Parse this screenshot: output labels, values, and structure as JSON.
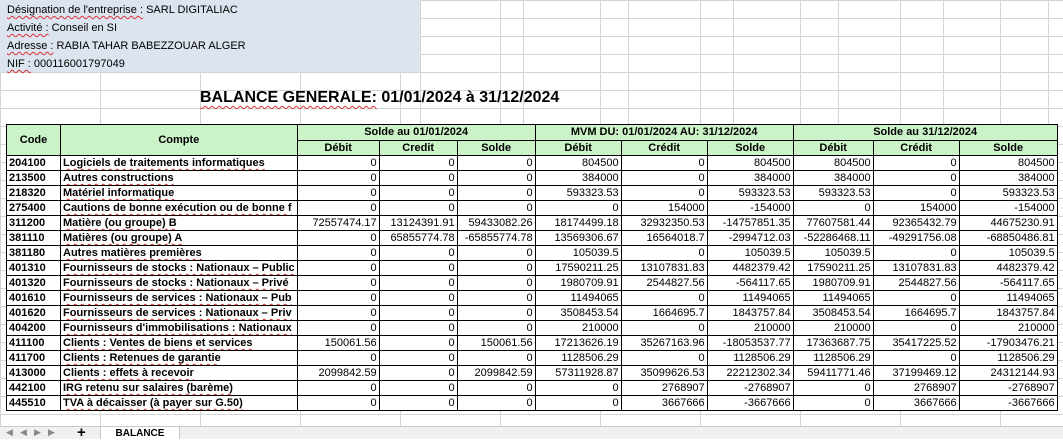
{
  "company": {
    "designation_label": "Désignation de l'entreprise :",
    "designation_value": "SARL DIGITALIAC",
    "activity_label": "Activité :",
    "activity_value": "Conseil en SI",
    "address_label": "Adresse :",
    "address_value": "RABIA TAHAR BABEZZOUAR ALGER",
    "nif_label": "NIF :",
    "nif_value": "000116001797049"
  },
  "title": {
    "main": "BALANCE GENERALE:",
    "period": "01/01/2024 à 31/12/2024"
  },
  "table": {
    "col_code": "Code",
    "col_compte": "Compte",
    "group1": "Solde au 01/01/2024",
    "group2": "MVM DU: 01/01/2024 AU: 31/12/2024",
    "group3": "Solde au 31/12/2024",
    "sub": {
      "debit": "Débit",
      "credit1": "Credit",
      "credit2": "Crédit",
      "solde": "Solde"
    },
    "rows": [
      {
        "code": "204100",
        "compte": "Logiciels de traitements informatiques",
        "v": [
          "0",
          "0",
          "0",
          "804500",
          "0",
          "804500",
          "804500",
          "0",
          "804500"
        ]
      },
      {
        "code": "213500",
        "compte": "Autres constructions",
        "v": [
          "0",
          "0",
          "0",
          "384000",
          "0",
          "384000",
          "384000",
          "0",
          "384000"
        ]
      },
      {
        "code": "218320",
        "compte": "Matériel informatique",
        "v": [
          "0",
          "0",
          "0",
          "593323.53",
          "0",
          "593323.53",
          "593323.53",
          "0",
          "593323.53"
        ]
      },
      {
        "code": "275400",
        "compte": "Cautions de bonne exécution ou de bonne f",
        "v": [
          "0",
          "0",
          "0",
          "0",
          "154000",
          "-154000",
          "0",
          "154000",
          "-154000"
        ]
      },
      {
        "code": "311200",
        "compte": "Matière (ou groupe) B",
        "v": [
          "72557474.17",
          "13124391.91",
          "59433082.26",
          "18174499.18",
          "32932350.53",
          "-14757851.35",
          "77607581.44",
          "92365432.79",
          "44675230.91"
        ]
      },
      {
        "code": "381110",
        "compte": "Matières (ou groupe) A",
        "v": [
          "0",
          "65855774.78",
          "-65855774.78",
          "13569306.67",
          "16564018.7",
          "-2994712.03",
          "-52286468.11",
          "-49291756.08",
          "-68850486.81"
        ]
      },
      {
        "code": "381180",
        "compte": "Autres matières premières",
        "v": [
          "0",
          "0",
          "0",
          "105039.5",
          "0",
          "105039.5",
          "105039.5",
          "0",
          "105039.5"
        ]
      },
      {
        "code": "401310",
        "compte": "Fournisseurs de stocks : Nationaux – Public",
        "v": [
          "0",
          "0",
          "0",
          "17590211.25",
          "13107831.83",
          "4482379.42",
          "17590211.25",
          "13107831.83",
          "4482379.42"
        ]
      },
      {
        "code": "401320",
        "compte": "Fournisseurs de stocks : Nationaux – Privé",
        "v": [
          "0",
          "0",
          "0",
          "1980709.91",
          "2544827.56",
          "-564117.65",
          "1980709.91",
          "2544827.56",
          "-564117.65"
        ]
      },
      {
        "code": "401610",
        "compte": "Fournisseurs de services : Nationaux – Pub",
        "v": [
          "0",
          "0",
          "0",
          "11494065",
          "0",
          "11494065",
          "11494065",
          "0",
          "11494065"
        ]
      },
      {
        "code": "401620",
        "compte": "Fournisseurs de services : Nationaux – Priv",
        "v": [
          "0",
          "0",
          "0",
          "3508453.54",
          "1664695.7",
          "1843757.84",
          "3508453.54",
          "1664695.7",
          "1843757.84"
        ]
      },
      {
        "code": "404200",
        "compte": "Fournisseurs d'immobilisations : Nationaux",
        "v": [
          "0",
          "0",
          "0",
          "210000",
          "0",
          "210000",
          "210000",
          "0",
          "210000"
        ]
      },
      {
        "code": "411100",
        "compte": "Clients : Ventes de biens et services",
        "v": [
          "150061.56",
          "0",
          "150061.56",
          "17213626.19",
          "35267163.96",
          "-18053537.77",
          "17363687.75",
          "35417225.52",
          "-17903476.21"
        ]
      },
      {
        "code": "411700",
        "compte": "Clients : Retenues de garantie",
        "v": [
          "0",
          "0",
          "0",
          "1128506.29",
          "0",
          "1128506.29",
          "1128506.29",
          "0",
          "1128506.29"
        ]
      },
      {
        "code": "413000",
        "compte": "Clients : effets à recevoir",
        "v": [
          "2099842.59",
          "0",
          "2099842.59",
          "57311928.87",
          "35099626.53",
          "22212302.34",
          "59411771.46",
          "37199469.12",
          "24312144.93"
        ]
      },
      {
        "code": "442100",
        "compte": "IRG retenu sur salaires (barème)",
        "v": [
          "0",
          "0",
          "0",
          "0",
          "2768907",
          "-2768907",
          "0",
          "2768907",
          "-2768907"
        ]
      },
      {
        "code": "445510",
        "compte": "TVA à décaisser (à payer sur G.50)",
        "v": [
          "0",
          "0",
          "0",
          "0",
          "3667666",
          "-3667666",
          "0",
          "3667666",
          "-3667666"
        ]
      }
    ]
  },
  "sheet_tab": {
    "add_label": "+",
    "active_tab": "BALANCE"
  }
}
